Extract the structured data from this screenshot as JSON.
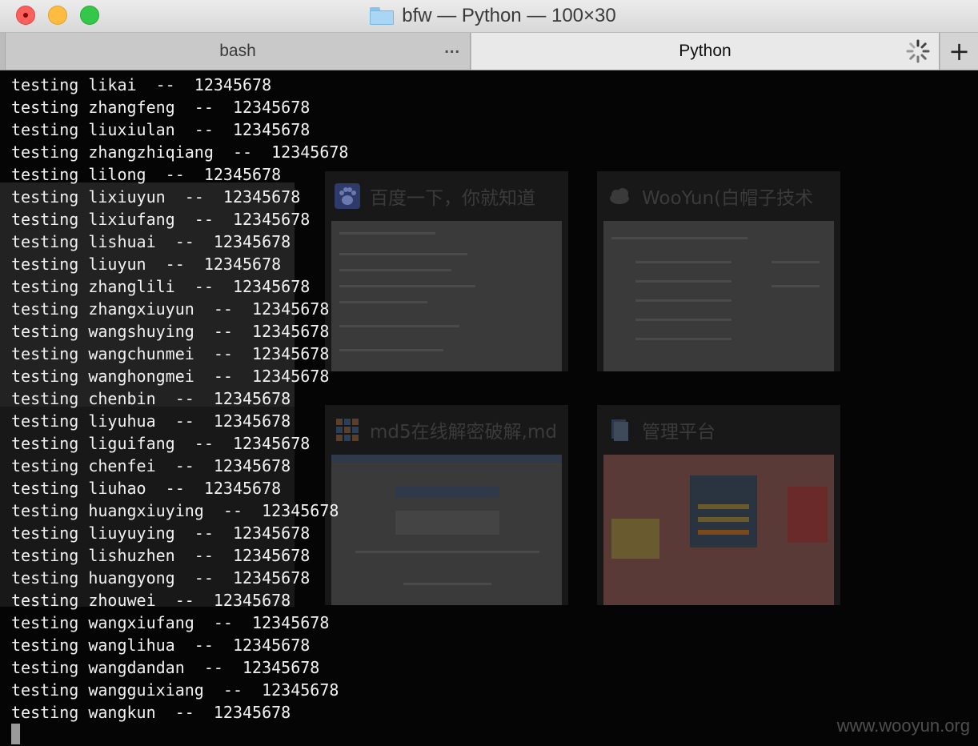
{
  "window": {
    "title": "bfw — Python — 100×30"
  },
  "tabs": [
    {
      "label": "bash",
      "active": false,
      "menu": "..."
    },
    {
      "label": "Python",
      "active": true
    }
  ],
  "new_tab_symbol": "+",
  "background_tiles": [
    {
      "title": "百度一下，你就知道",
      "icon": "baidu-paw-icon"
    },
    {
      "title": "WooYun(白帽子技术",
      "icon": "wooyun-cloud-icon"
    },
    {
      "title": "md5在线解密破解,md",
      "icon": "md5-grid-icon"
    },
    {
      "title": "管理平台",
      "icon": "document-icon"
    }
  ],
  "terminal": {
    "lines": [
      "testing likai  --  12345678",
      "testing zhangfeng  --  12345678",
      "testing liuxiulan  --  12345678",
      "testing zhangzhiqiang  --  12345678",
      "testing lilong  --  12345678",
      "testing lixiuyun  --  12345678",
      "testing lixiufang  --  12345678",
      "testing lishuai  --  12345678",
      "testing liuyun  --  12345678",
      "testing zhanglili  --  12345678",
      "testing zhangxiuyun  --  12345678",
      "testing wangshuying  --  12345678",
      "testing wangchunmei  --  12345678",
      "testing wanghongmei  --  12345678",
      "testing chenbin  --  12345678",
      "testing liyuhua  --  12345678",
      "testing liguifang  --  12345678",
      "testing chenfei  --  12345678",
      "testing liuhao  --  12345678",
      "testing huangxiuying  --  12345678",
      "testing liuyuying  --  12345678",
      "testing lishuzhen  --  12345678",
      "testing huangyong  --  12345678",
      "testing zhouwei  --  12345678",
      "testing wangxiufang  --  12345678",
      "testing wanglihua  --  12345678",
      "testing wangdandan  --  12345678",
      "testing wangguixiang  --  12345678",
      "testing wangkun  --  12345678"
    ]
  },
  "watermark": "www.wooyun.org",
  "colors": {
    "terminal_bg": "#050505",
    "terminal_text": "#f2f2f2",
    "close": "#fc605c",
    "minimize": "#fdbc40",
    "maximize": "#34c84a"
  }
}
